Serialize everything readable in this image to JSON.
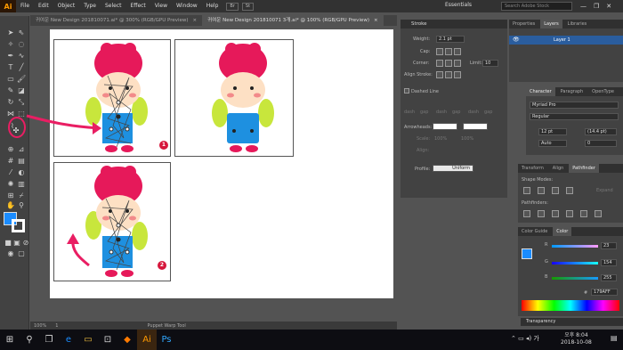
{
  "app": {
    "logo": "Ai",
    "menu": [
      "File",
      "Edit",
      "Object",
      "Type",
      "Select",
      "Effect",
      "View",
      "Window",
      "Help"
    ],
    "mini_buttons": [
      "Br",
      "St"
    ],
    "workspace": "Essentials",
    "search_placeholder": "Search Adobe Stock",
    "window_controls": [
      "—",
      "❐",
      "✕"
    ]
  },
  "tabs": [
    {
      "label": "귀여운 New Design 201810071.ai* @ 300% (RGB/GPU Preview)",
      "close": "×"
    },
    {
      "label": "귀여운 New Design 201810071 3개.ai* @ 100% (RGB/GPU Preview)",
      "close": "×"
    }
  ],
  "status": {
    "zoom": "100%",
    "page": "1",
    "tool": "Puppet Warp Tool"
  },
  "artboard_badges": [
    "1",
    "2"
  ],
  "stroke_panel": {
    "title": "Stroke",
    "weight_label": "Weight:",
    "weight_value": "2.1 pt",
    "cap_label": "Cap:",
    "corner_label": "Corner:",
    "limit_label": "Limit:",
    "limit_value": "10",
    "align_label": "Align Stroke:",
    "dashed_label": "Dashed Line",
    "dash_labels": [
      "dash",
      "gap",
      "dash",
      "gap",
      "dash",
      "gap"
    ],
    "arrowheads_label": "Arrowheads:",
    "scale_label": "Scale:",
    "scale_value_1": "100%",
    "scale_value_2": "100%",
    "align_label2": "Align:",
    "profile_label": "Profile:",
    "profile_value": "Uniform"
  },
  "layers_panel": {
    "tabs": [
      "Properties",
      "Layers",
      "Libraries"
    ],
    "layer_name": "Layer 1"
  },
  "character_panel": {
    "tabs": [
      "Character",
      "Paragraph",
      "OpenType"
    ],
    "font": "Myriad Pro",
    "style": "Regular",
    "size": "12 pt",
    "leading": "(14.4 pt)",
    "kerning": "Auto",
    "tracking": "0"
  },
  "pathfinder_panel": {
    "tabs": [
      "Transform",
      "Align",
      "Pathfinder"
    ],
    "shape_modes": "Shape Modes:",
    "pathfinders": "Pathfinders:",
    "expand": "Expand"
  },
  "color_panel": {
    "tabs": [
      "Color Guide",
      "Color"
    ],
    "r_label": "R",
    "g_label": "G",
    "b_label": "B",
    "r": "23",
    "g": "154",
    "b": "255",
    "hex": "179AFF"
  },
  "transparency_label": "Transparency",
  "taskbar": {
    "time": "오후 8:04",
    "date": "2018-10-08"
  },
  "colors": {
    "accent": "#1a8cff",
    "highlight": "#e91e63",
    "badge": "#d6173c",
    "bear_hat": "#e6195a",
    "overalls": "#1e90e0",
    "sleeve": "#c8e63c"
  }
}
